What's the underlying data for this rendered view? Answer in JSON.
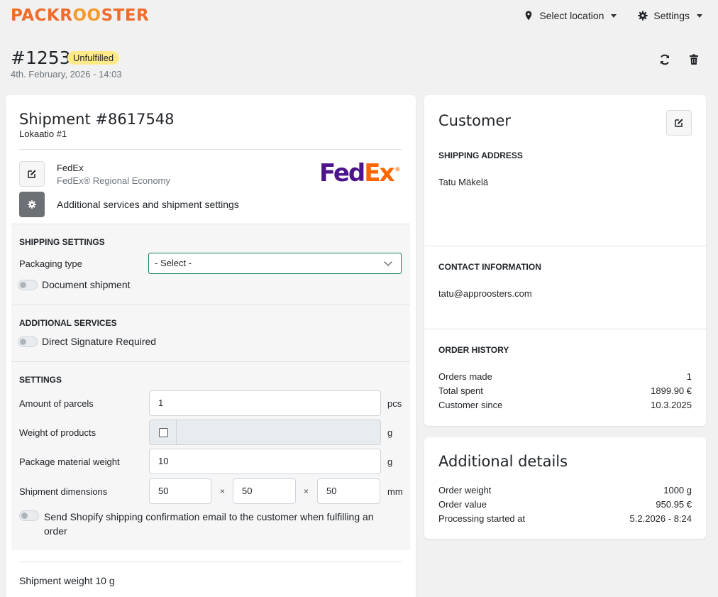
{
  "brand": {
    "logo_pack": "PACKR",
    "logo_roo": "OO",
    "logo_ster": "STER",
    "accent": "#ef6c2a"
  },
  "topbar": {
    "location_label": "Select location",
    "location_icon": "map-marker-icon",
    "settings_label": "Settings",
    "settings_icon": "gear-icon"
  },
  "order": {
    "number": "#1253",
    "status": "Unfulfilled",
    "status_color": "#ffea8a",
    "date": "4th. February, 2026 - 14:03"
  },
  "shipment": {
    "title": "Shipment #8617548",
    "location": "Lokaatio #1",
    "carrier": "FedEx",
    "service": "FedEx® Regional Economy",
    "carrier_logo_fed": "Fed",
    "carrier_logo_ex": "Ex",
    "carrier_logo_reg": "®",
    "additional_services_label": "Additional services and shipment settings",
    "shipping_settings_title": "SHIPPING SETTINGS",
    "packaging_type_label": "Packaging type",
    "packaging_type_value": "- Select -",
    "document_shipment_label": "Document shipment",
    "additional_services_title": "ADDITIONAL SERVICES",
    "direct_signature_label": "Direct Signature Required",
    "settings_title": "SETTINGS",
    "parcels_label": "Amount of parcels",
    "parcels_value": "1",
    "parcels_unit": "pcs",
    "weight_products_label": "Weight of products",
    "weight_unit": "g",
    "material_weight_label": "Package material weight",
    "material_weight_value": "10",
    "dimensions_label": "Shipment dimensions",
    "dim_x": "50",
    "dim_y": "50",
    "dim_z": "50",
    "dim_sep": "×",
    "dim_unit": "mm",
    "send_email_label_1": "Send Shopify shipping confirmation email to the customer when fulfilling an",
    "send_email_label_2": "order",
    "shipment_weight": "Shipment weight 10 g"
  },
  "customer": {
    "title": "Customer",
    "shipping_address_title": "SHIPPING ADDRESS",
    "name": "Tatu Mäkelä",
    "contact_title": "CONTACT INFORMATION",
    "email": "tatu@approosters.com",
    "order_history_title": "ORDER HISTORY",
    "history": [
      {
        "label": "Orders made",
        "value": "1"
      },
      {
        "label": "Total spent",
        "value": "1899.90 €"
      },
      {
        "label": "Customer since",
        "value": "10.3.2025"
      }
    ]
  },
  "additional_details": {
    "title": "Additional details",
    "rows": [
      {
        "label": "Order weight",
        "value": "1000 g"
      },
      {
        "label": "Order value",
        "value": "950.95 €"
      },
      {
        "label": "Processing started at",
        "value": "5.2.2026 - 8:24"
      }
    ]
  }
}
